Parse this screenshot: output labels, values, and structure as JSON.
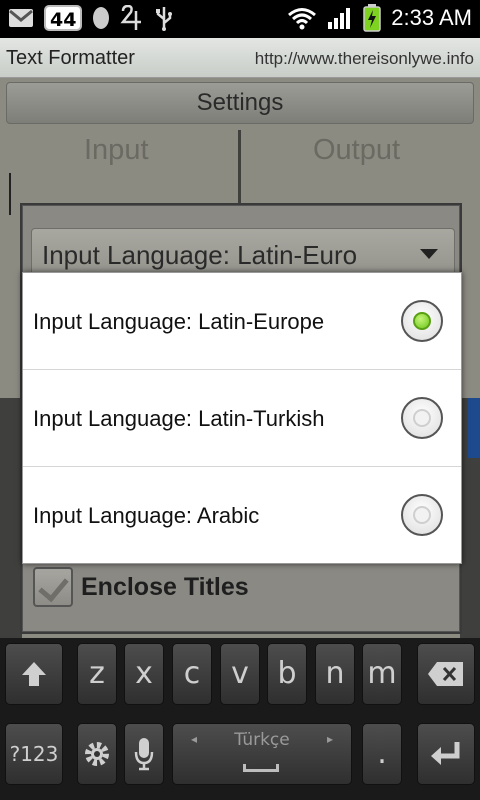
{
  "status_bar": {
    "notification_badge": "44",
    "time": "2:33 AM"
  },
  "app": {
    "title": "Text Formatter",
    "url": "http://www.thereisonlywe.info"
  },
  "background": {
    "settings_label": "Settings",
    "input_label": "Input",
    "output_label": "Output",
    "spinner_text": "Input Language: Latin-Euro",
    "enclose_titles_label": "Enclose Titles"
  },
  "dialog": {
    "options": [
      {
        "label": "Input Language: Latin-Europe",
        "selected": true
      },
      {
        "label": "Input Language: Latin-Turkish",
        "selected": false
      },
      {
        "label": "Input Language: Arabic",
        "selected": false
      }
    ]
  },
  "keyboard": {
    "row1": [
      "z",
      "x",
      "c",
      "v",
      "b",
      "n",
      "m"
    ],
    "symbols_label": "?123",
    "space_language": "Türkçe",
    "period_label": "."
  },
  "colors": {
    "radio_selected": "#6cc51b",
    "battery": "#7ed321",
    "dim_overlay": "#8c8b82"
  }
}
